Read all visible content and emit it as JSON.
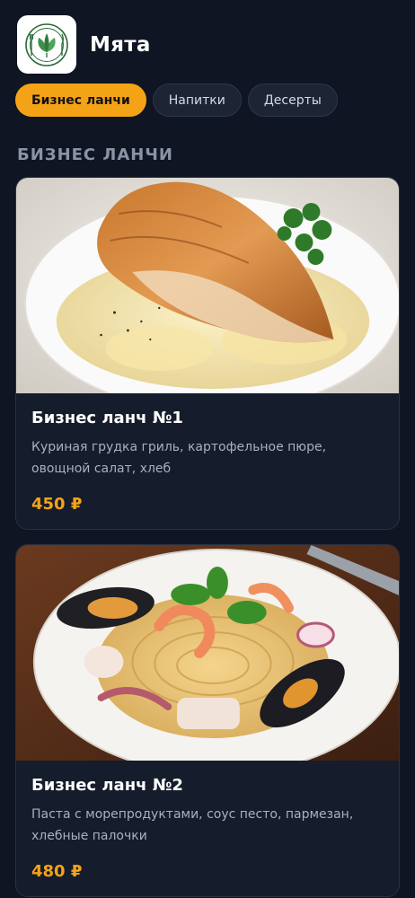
{
  "header": {
    "title": "Мята",
    "logo_icon": "mint-leaf-plate-logo-icon"
  },
  "tabs": [
    {
      "label": "Бизнес ланчи",
      "active": true
    },
    {
      "label": "Напитки",
      "active": false
    },
    {
      "label": "Десерты",
      "active": false
    }
  ],
  "section": {
    "title": "БИЗНЕС ЛАНЧИ"
  },
  "items": [
    {
      "title": "Бизнес ланч №1",
      "description": "Куриная грудка гриль, картофельное пюре, овощной салат, хлеб",
      "price": "450 ₽",
      "image": "grilled-chicken-mashed-potato-image"
    },
    {
      "title": "Бизнес ланч №2",
      "description": "Паста с морепродуктами, соус песто, пармезан, хлебные палочки",
      "price": "480 ₽",
      "image": "seafood-pasta-image"
    }
  ],
  "colors": {
    "background": "#0f1523",
    "card": "#151c2b",
    "accent": "#f5a316",
    "muted_text": "#a9b0bf"
  }
}
